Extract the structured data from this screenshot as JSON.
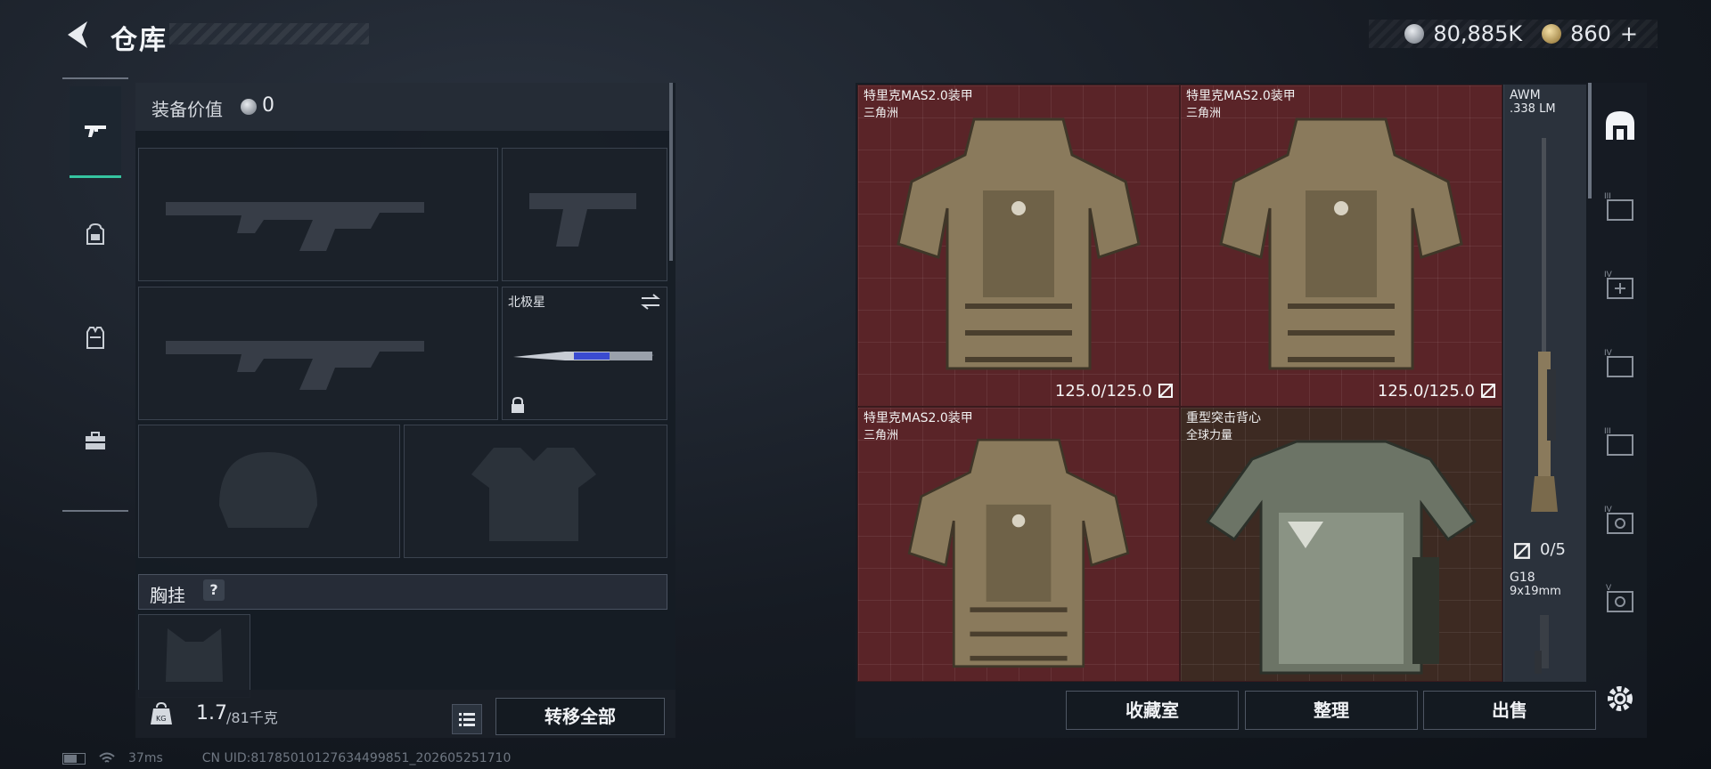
{
  "header": {
    "title": "仓库"
  },
  "currency": {
    "silver_value": "80,885K",
    "gold_value": "860",
    "gold_plus": "+"
  },
  "left_nav": {
    "items": [
      {
        "name": "gun-icon",
        "active": true
      },
      {
        "name": "backpack-icon",
        "active": false
      },
      {
        "name": "vest-icon",
        "active": false
      },
      {
        "name": "toolbox-icon",
        "active": false
      }
    ]
  },
  "loadout": {
    "equip_value_label": "装备价值",
    "equip_value": "0",
    "knife_name": "北极星",
    "rig_label": "胸挂",
    "rig_help": "?",
    "weight_current": "1.7",
    "weight_max": "/81千克",
    "transfer_all": "转移全部"
  },
  "storage": {
    "items": [
      {
        "name": "特里克MAS2.0装甲",
        "sub": "三角洲",
        "durability": "125.0/125.0"
      },
      {
        "name": "特里克MAS2.0装甲",
        "sub": "三角洲",
        "durability": "125.0/125.0"
      },
      {
        "name": "特里克MAS2.0装甲",
        "sub": "三角洲",
        "durability": ""
      },
      {
        "name": "重型突击背心",
        "sub": "全球力量",
        "durability": ""
      }
    ],
    "awm": {
      "name": "AWM",
      "caliber": ".338 LM"
    },
    "mag_count": "0/5",
    "g18": {
      "name": "G18",
      "caliber": "9x19mm"
    },
    "collection": "收藏室",
    "organize": "整理",
    "sell": "出售"
  },
  "status": {
    "ping": "37ms",
    "uid": "CN UID:81785010127634499851_202605251710"
  },
  "colors": {
    "accent": "#35c4a0",
    "item_bg_red": "#5a2428",
    "item_bg_brown": "#3d2a22"
  }
}
